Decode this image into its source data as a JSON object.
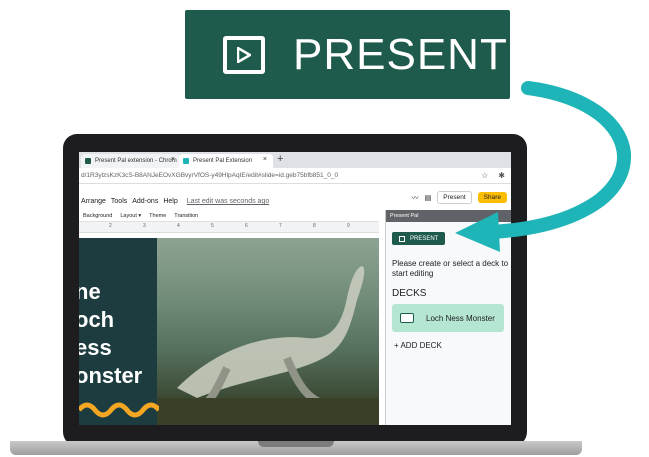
{
  "badge": {
    "label": "PRESENT",
    "icon": "play-box-icon",
    "bg": "#1f5b4c"
  },
  "accent_arrow_color": "#1fb5b8",
  "browser": {
    "tabs": [
      {
        "label": "Present Pal extension - Chrom"
      },
      {
        "label": "Present Pal Extension"
      }
    ],
    "new_tab": "+",
    "url": "d/1R3ylzsKzK3cS-B8ANJeEOvXGBvyrVfOS-y49HlpAqIE/edit#slide=id.geb75bfb851_0_0"
  },
  "slides_app": {
    "menu": [
      "Arrange",
      "Tools",
      "Add-ons",
      "Help"
    ],
    "last_edit": "Last edit was seconds ago",
    "present_button": "Present",
    "share_button": "Share",
    "toolbar": [
      "Background",
      "Layout ▾",
      "Theme",
      "Transition"
    ],
    "ruler_ticks": [
      "2",
      "3",
      "4",
      "5",
      "6",
      "7",
      "8",
      "9"
    ],
    "slide_title_lines": [
      "ne",
      "och",
      "ess",
      "onster"
    ]
  },
  "panel": {
    "header": "Present Pal",
    "present_label": "PRESENT",
    "message": "Please create or select a deck to start editing",
    "decks_heading": "DECKS",
    "decks": [
      {
        "name": "Loch Ness Monster"
      }
    ],
    "add_deck": "+ ADD DECK"
  }
}
